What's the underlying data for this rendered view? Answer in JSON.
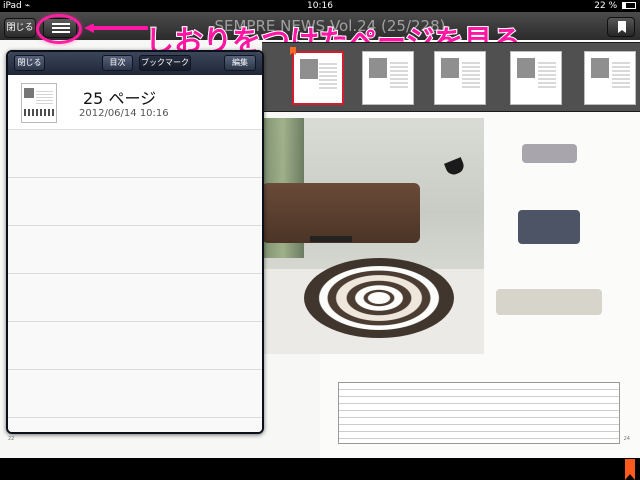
{
  "status": {
    "carrier": "iPad",
    "time": "10:16",
    "battery": "22 %"
  },
  "toolbar": {
    "close_label": "閉じる",
    "title": "SEMPRE NEWS Vol.24 (25/228)"
  },
  "annotation": {
    "text": "しおりをつけたページを見る"
  },
  "popover": {
    "close_label": "閉じる",
    "toc_label": "目次",
    "bookmark_label": "ブックマーク",
    "edit_label": "編集",
    "entries": [
      {
        "page": "25 ページ",
        "date": "2012/06/14 10:16"
      }
    ]
  },
  "colors": {
    "annotation": "#ff16a2",
    "toolbar": "#262626",
    "popover_header": "#283044",
    "selected_thumb": "#d51b2c",
    "bookmark_marker": "#ff5a1e"
  },
  "icons": {
    "wifi": "wifi-icon",
    "list": "list-icon",
    "bookmark": "bookmark-icon"
  },
  "magazine": {
    "left_page": "22",
    "right_page": "24"
  }
}
